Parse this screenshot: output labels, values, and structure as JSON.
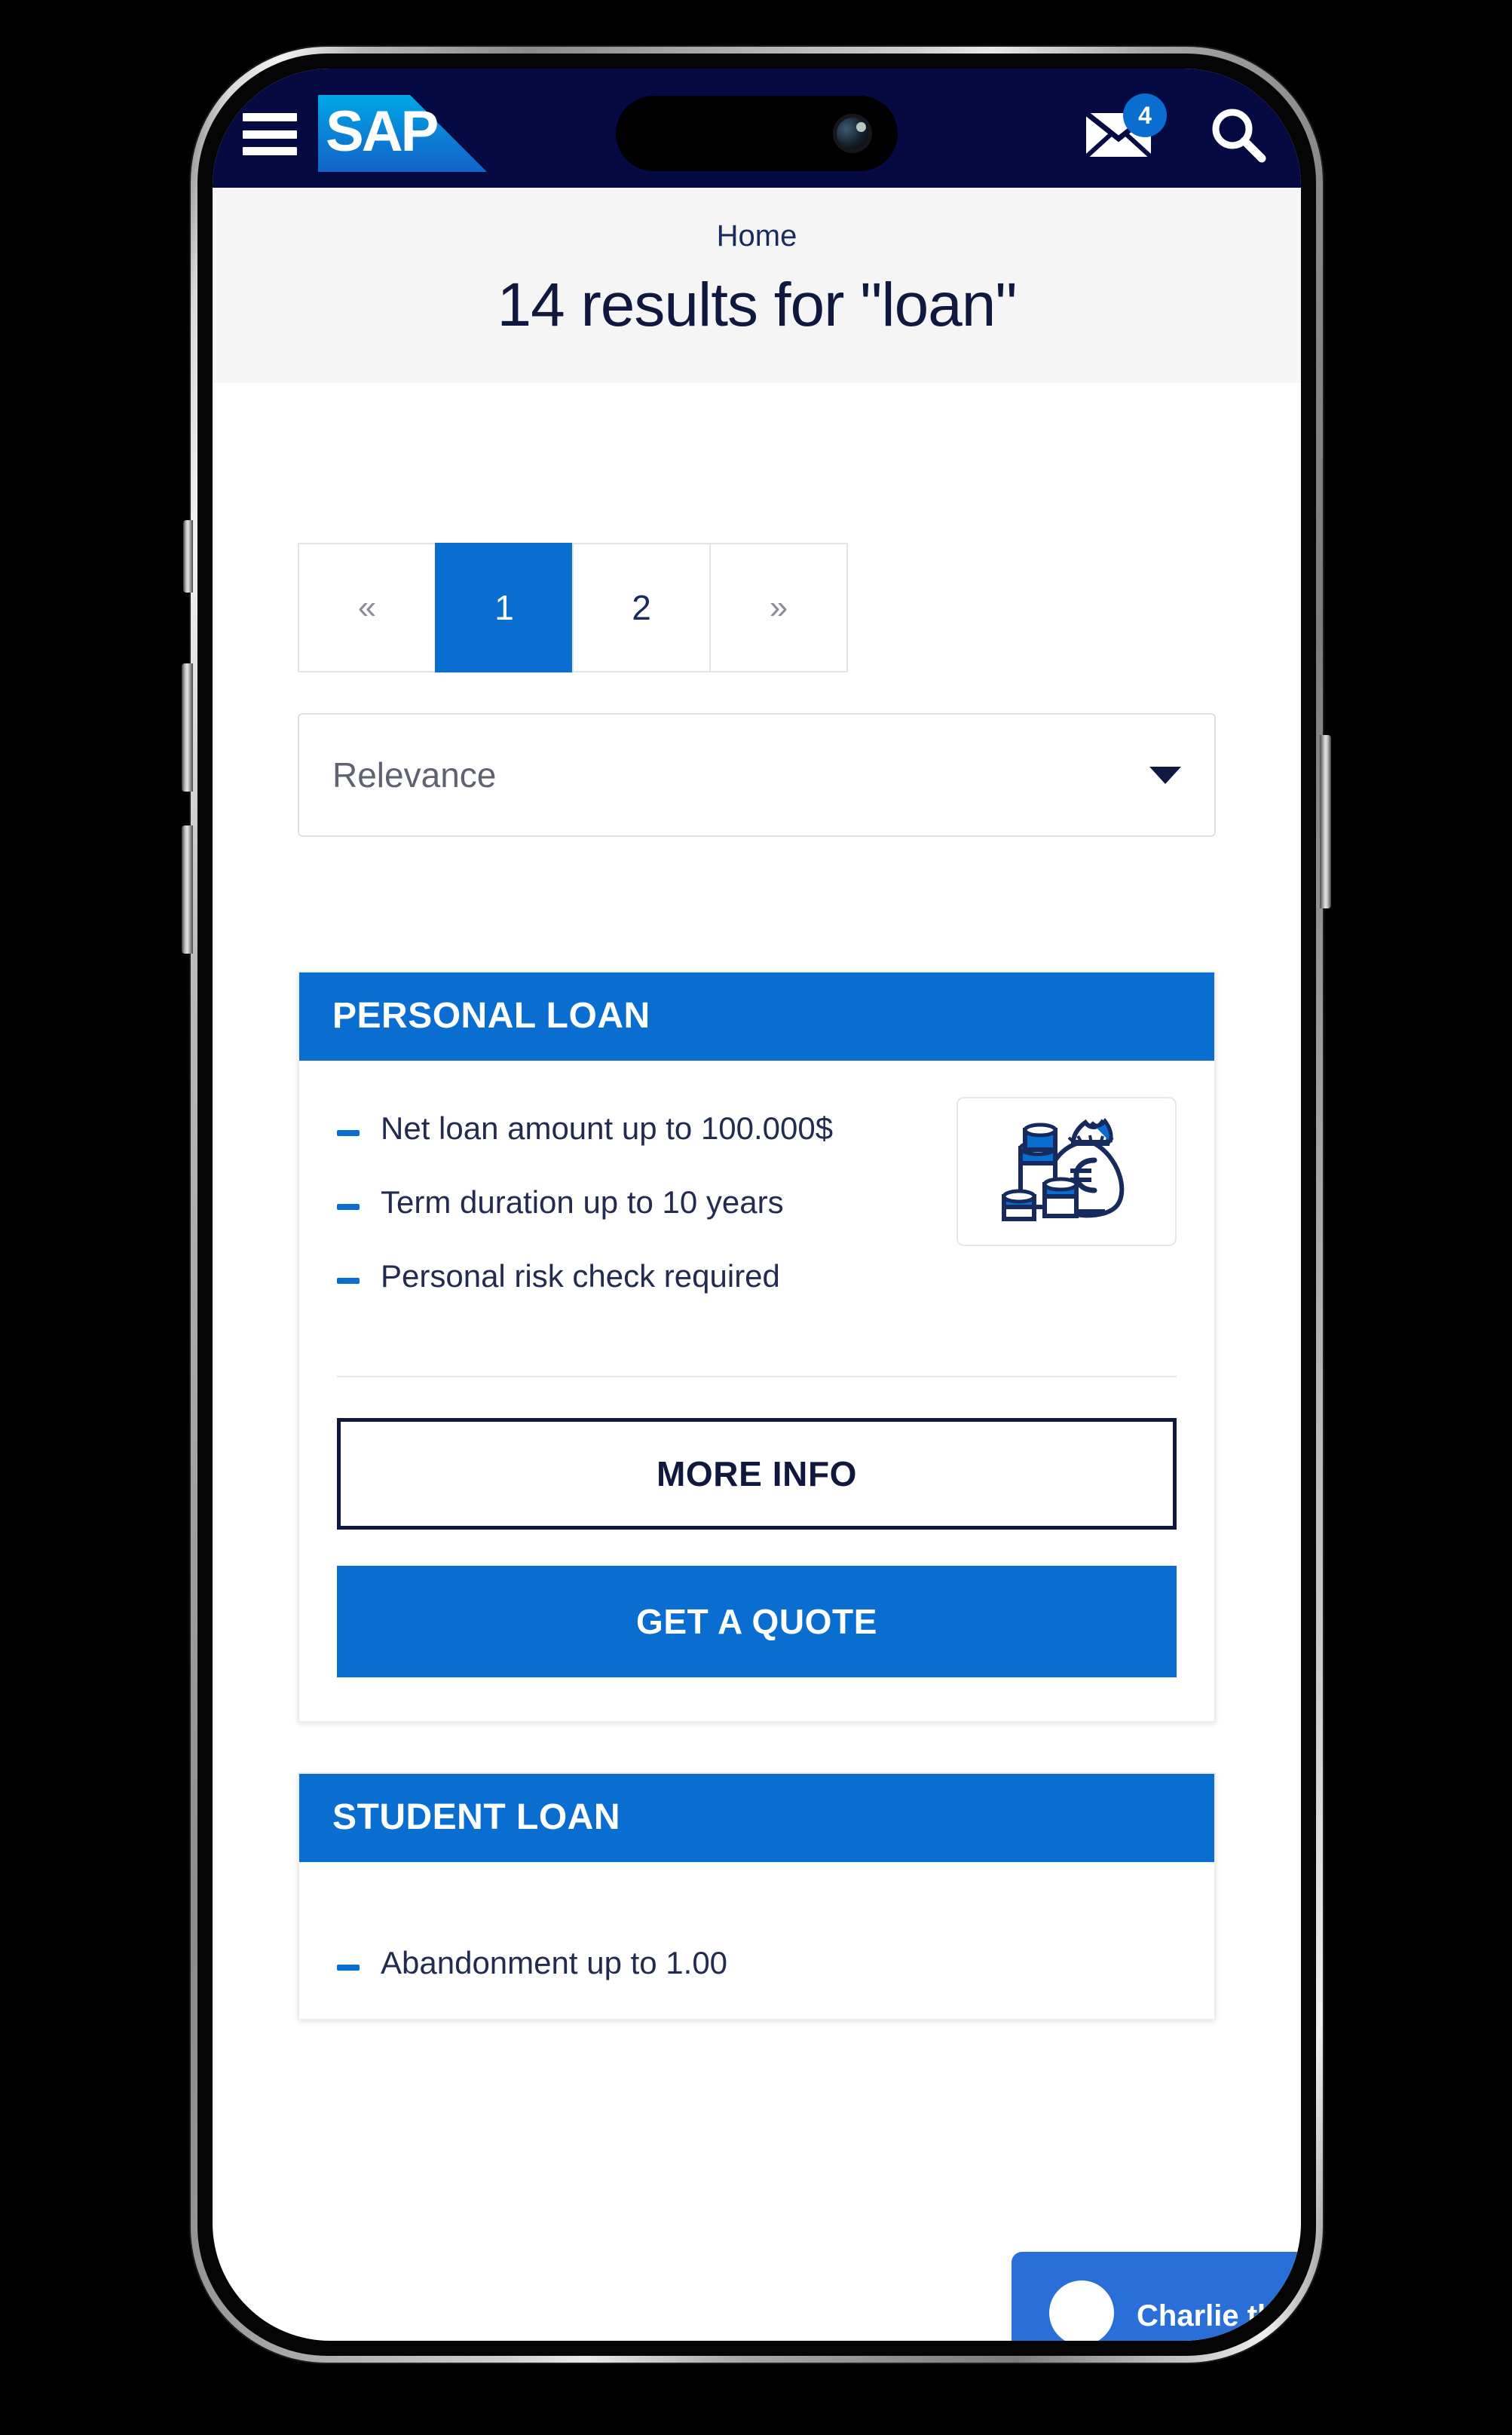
{
  "header": {
    "menu_icon": "hamburger-menu-icon",
    "logo_text": "SAP",
    "mail_icon": "mail-icon",
    "mail_badge": "4",
    "search_icon": "search-icon",
    "bg_color": "#050a42"
  },
  "titlebar": {
    "breadcrumb": "Home",
    "title": "14 results for \"loan\""
  },
  "pagination": {
    "prev": "«",
    "pages": [
      "1",
      "2"
    ],
    "active_page": "1",
    "next": "»"
  },
  "sort": {
    "selected": "Relevance",
    "caret_icon": "chevron-down-icon"
  },
  "results": [
    {
      "title": "PERSONAL LOAN",
      "bullets": [
        "Net loan amount up to 100.000$",
        "Term duration up to 10 years",
        "Personal risk check required"
      ],
      "icon": "money-bag-euro-icon",
      "more_info_label": "MORE INFO",
      "quote_label": "GET A QUOTE"
    },
    {
      "title": "STUDENT LOAN",
      "bullets": [
        "Abandonment up to 1.00"
      ]
    }
  ],
  "chatbot": {
    "label": "Charlie the Chatbot",
    "avatar": "chatbot-avatar-icon"
  },
  "colors": {
    "brand_navy": "#050a42",
    "brand_blue": "#0a6ed1",
    "text_dark": "#10183f"
  }
}
